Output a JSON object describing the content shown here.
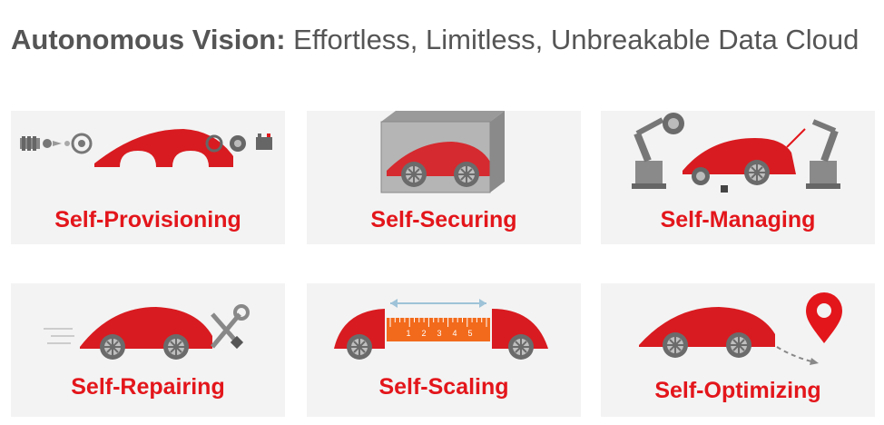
{
  "title": {
    "bold": "Autonomous Vision:",
    "rest": "Effortless, Limitless, Unbreakable Data Cloud"
  },
  "colors": {
    "accent": "#e3161b",
    "card_bg": "#f3f3f3",
    "title_text": "#555555",
    "car_body": "#d81b20",
    "tire": "#6b6b6b"
  },
  "cards": [
    {
      "label": "Self-Provisioning",
      "icon": "car-parts-assembly-icon"
    },
    {
      "label": "Self-Securing",
      "icon": "security-cube-icon"
    },
    {
      "label": "Self-Managing",
      "icon": "robot-arm-maintenance-icon"
    },
    {
      "label": "Self-Repairing",
      "icon": "wrench-screwdriver-icon"
    },
    {
      "label": "Self-Scaling",
      "icon": "ruler-extension-icon"
    },
    {
      "label": "Self-Optimizing",
      "icon": "map-pin-route-icon"
    }
  ],
  "ruler": {
    "ticks": [
      "1",
      "2",
      "3",
      "4",
      "5"
    ]
  }
}
